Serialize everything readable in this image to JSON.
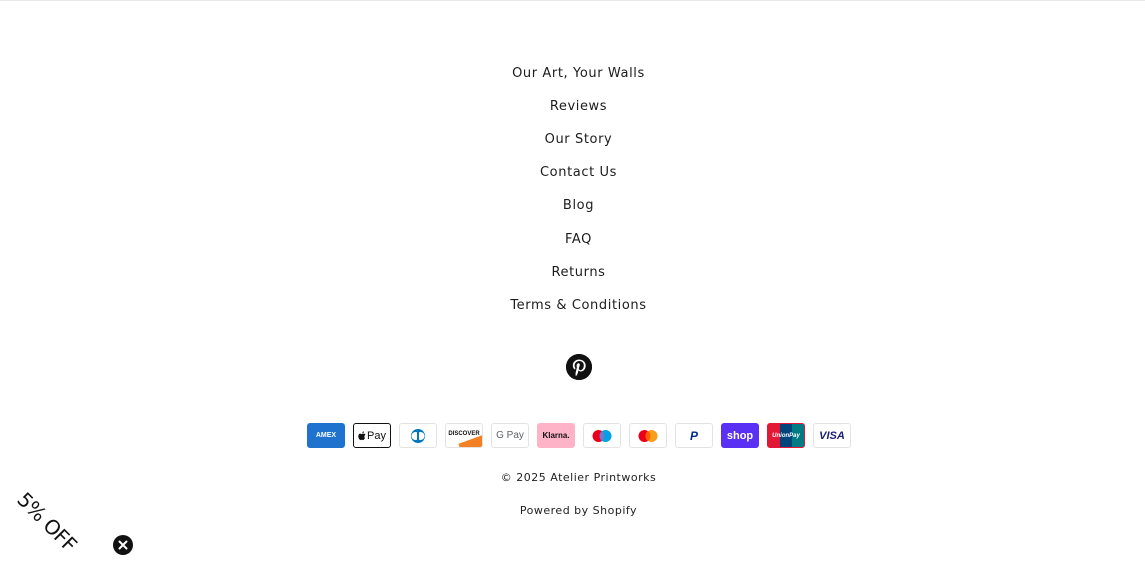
{
  "footer": {
    "links": [
      "Our Art, Your Walls",
      "Reviews",
      "Our Story",
      "Contact Us",
      "Blog",
      "FAQ",
      "Returns",
      "Terms & Conditions"
    ],
    "social": {
      "icon": "pinterest-icon"
    },
    "payments": {
      "amex": "AMEX",
      "applepay": "Pay",
      "discover": "DISCOVER",
      "googlepay": "G Pay",
      "klarna": "Klarna.",
      "paypal": "P",
      "shoppay": "shop",
      "unionpay": "UnionPay",
      "visa": "VISA"
    },
    "copyright": "© 2025 Atelier Printworks",
    "powered_by": "Powered by Shopify"
  },
  "promo": {
    "label": "5% OFF",
    "close_icon": "close-icon"
  },
  "colors": {
    "text": "#1c1c1c",
    "amex": "#1f72cd",
    "klarna": "#ffb3c7",
    "shoppay": "#5a31f4",
    "visa": "#1a1f71"
  }
}
